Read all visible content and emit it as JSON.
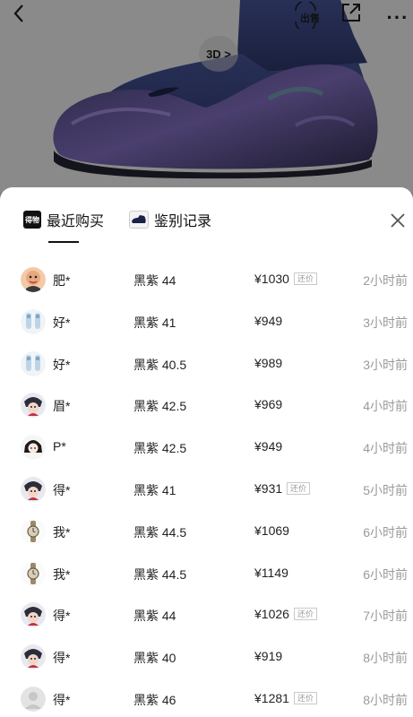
{
  "header": {
    "back_icon": "chevron-left-icon",
    "sell_label": "出售",
    "share_icon": "share-icon",
    "more_label": "···",
    "view3d_label": "3D >"
  },
  "tabs": {
    "recent": {
      "label": "最近购买",
      "icon_text": "得物"
    },
    "auth": {
      "label": "鉴别记录"
    }
  },
  "close_icon": "close-icon",
  "records": [
    {
      "name": "肥*",
      "spec": "黑紫 44",
      "price": "¥1030",
      "badge": "还价",
      "time": "2小时前",
      "avatar": "face"
    },
    {
      "name": "好*",
      "spec": "黑紫 41",
      "price": "¥949",
      "badge": "",
      "time": "3小时前",
      "avatar": "shoes"
    },
    {
      "name": "好*",
      "spec": "黑紫 40.5",
      "price": "¥989",
      "badge": "",
      "time": "3小时前",
      "avatar": "shoes"
    },
    {
      "name": "眉*",
      "spec": "黑紫 42.5",
      "price": "¥969",
      "badge": "",
      "time": "4小时前",
      "avatar": "anime"
    },
    {
      "name": "P*",
      "spec": "黑紫 42.5",
      "price": "¥949",
      "badge": "",
      "time": "4小时前",
      "avatar": "girl"
    },
    {
      "name": "得*",
      "spec": "黑紫 41",
      "price": "¥931",
      "badge": "还价",
      "time": "5小时前",
      "avatar": "anime"
    },
    {
      "name": "我*",
      "spec": "黑紫 44.5",
      "price": "¥1069",
      "badge": "",
      "time": "6小时前",
      "avatar": "watch"
    },
    {
      "name": "我*",
      "spec": "黑紫 44.5",
      "price": "¥1149",
      "badge": "",
      "time": "6小时前",
      "avatar": "watch"
    },
    {
      "name": "得*",
      "spec": "黑紫 44",
      "price": "¥1026",
      "badge": "还价",
      "time": "7小时前",
      "avatar": "anime"
    },
    {
      "name": "得*",
      "spec": "黑紫 40",
      "price": "¥919",
      "badge": "",
      "time": "8小时前",
      "avatar": "anime"
    },
    {
      "name": "得*",
      "spec": "黑紫 46",
      "price": "¥1281",
      "badge": "还价",
      "time": "8小时前",
      "avatar": "default"
    }
  ]
}
